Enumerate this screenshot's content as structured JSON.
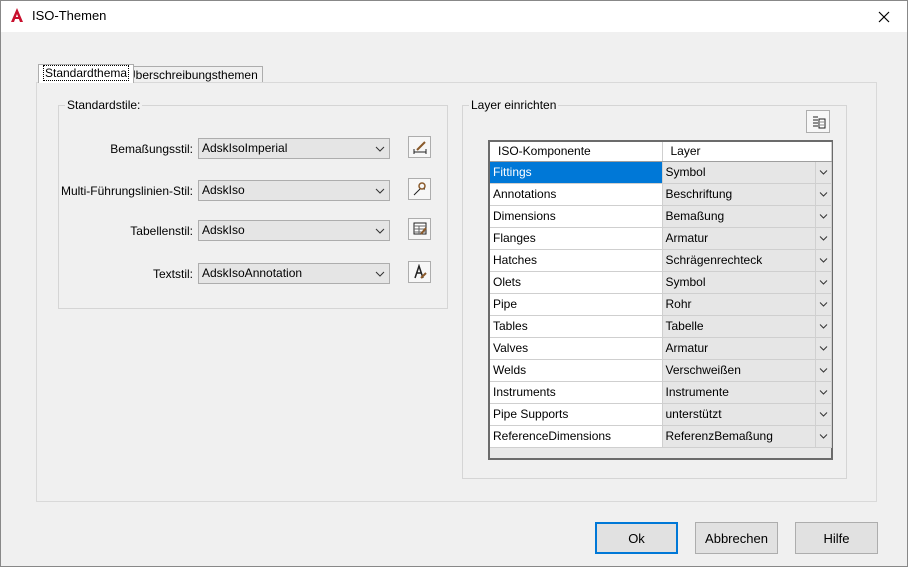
{
  "window": {
    "title": "ISO-Themen",
    "app_icon": "autocad-a-icon",
    "close_icon": "close-icon"
  },
  "tabs": [
    {
      "label": "Standardthema",
      "active": true
    },
    {
      "label": "Überschreibungsthemen",
      "active": false
    }
  ],
  "standard_styles": {
    "group_label": "Standardstile:",
    "rows": [
      {
        "label": "Bemaßungsstil:",
        "value": "AdskIsoImperial",
        "icon": "dimension-style-icon"
      },
      {
        "label": "Multi-Führungslinien-Stil:",
        "value": "AdskIso",
        "icon": "multileader-style-icon"
      },
      {
        "label": "Tabellenstil:",
        "value": "AdskIso",
        "icon": "table-style-icon"
      },
      {
        "label": "Textstil:",
        "value": "AdskIsoAnnotation",
        "icon": "text-style-icon"
      }
    ]
  },
  "layer_setup": {
    "group_label": "Layer einrichten",
    "toolbar_icon": "layer-properties-icon",
    "columns": [
      "ISO-Komponente",
      "Layer"
    ],
    "rows": [
      {
        "component": "Fittings",
        "layer": "Symbol",
        "selected": true
      },
      {
        "component": "Annotations",
        "layer": "Beschriftung"
      },
      {
        "component": "Dimensions",
        "layer": "Bemaßung"
      },
      {
        "component": "Flanges",
        "layer": "Armatur"
      },
      {
        "component": "Hatches",
        "layer": "Schrägenrechteck"
      },
      {
        "component": "Olets",
        "layer": "Symbol"
      },
      {
        "component": "Pipe",
        "layer": "Rohr"
      },
      {
        "component": "Tables",
        "layer": "Tabelle"
      },
      {
        "component": "Valves",
        "layer": "Armatur"
      },
      {
        "component": "Welds",
        "layer": "Verschweißen"
      },
      {
        "component": "Instruments",
        "layer": "Instrumente"
      },
      {
        "component": "Pipe Supports",
        "layer": "unterstützt"
      },
      {
        "component": "ReferenceDimensions",
        "layer": "ReferenzBemaßung"
      }
    ]
  },
  "buttons": {
    "ok": "Ok",
    "cancel": "Abbrechen",
    "help": "Hilfe"
  },
  "colors": {
    "selection": "#0078d7",
    "app_red": "#c8102e"
  }
}
